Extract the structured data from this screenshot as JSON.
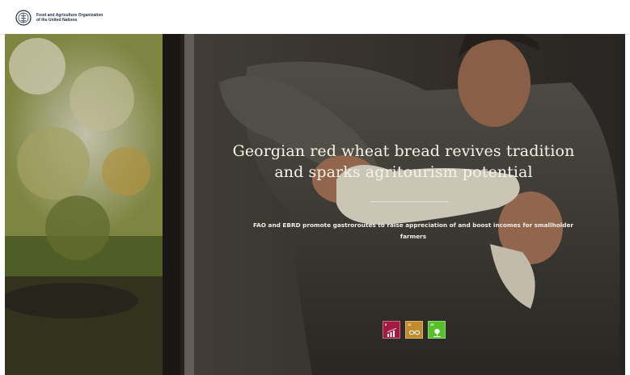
{
  "header": {
    "org_line1": "Food and Agriculture Organization",
    "org_line2": "of the United Nations",
    "logo_icon": "fao-emblem-icon"
  },
  "hero": {
    "title_line1": "Georgian red wheat bread revives tradition",
    "title_line2": "and sparks agritourism potential",
    "subtitle_line1": "FAO and EBRD promote gastroroutes to raise appreciation of and boost incomes for smallholder",
    "subtitle_line2": "farmers"
  },
  "sdg_icons": [
    {
      "name": "sdg-8-icon",
      "number": "8",
      "color": "#a21942"
    },
    {
      "name": "sdg-12-icon",
      "number": "12",
      "color": "#bf8b2e"
    },
    {
      "name": "sdg-15-icon",
      "number": "15",
      "color": "#56c02b"
    }
  ],
  "colors": {
    "header_bg": "#ffffff",
    "title_text": "#f7f3ea",
    "hero_dark": "#2a2622"
  }
}
